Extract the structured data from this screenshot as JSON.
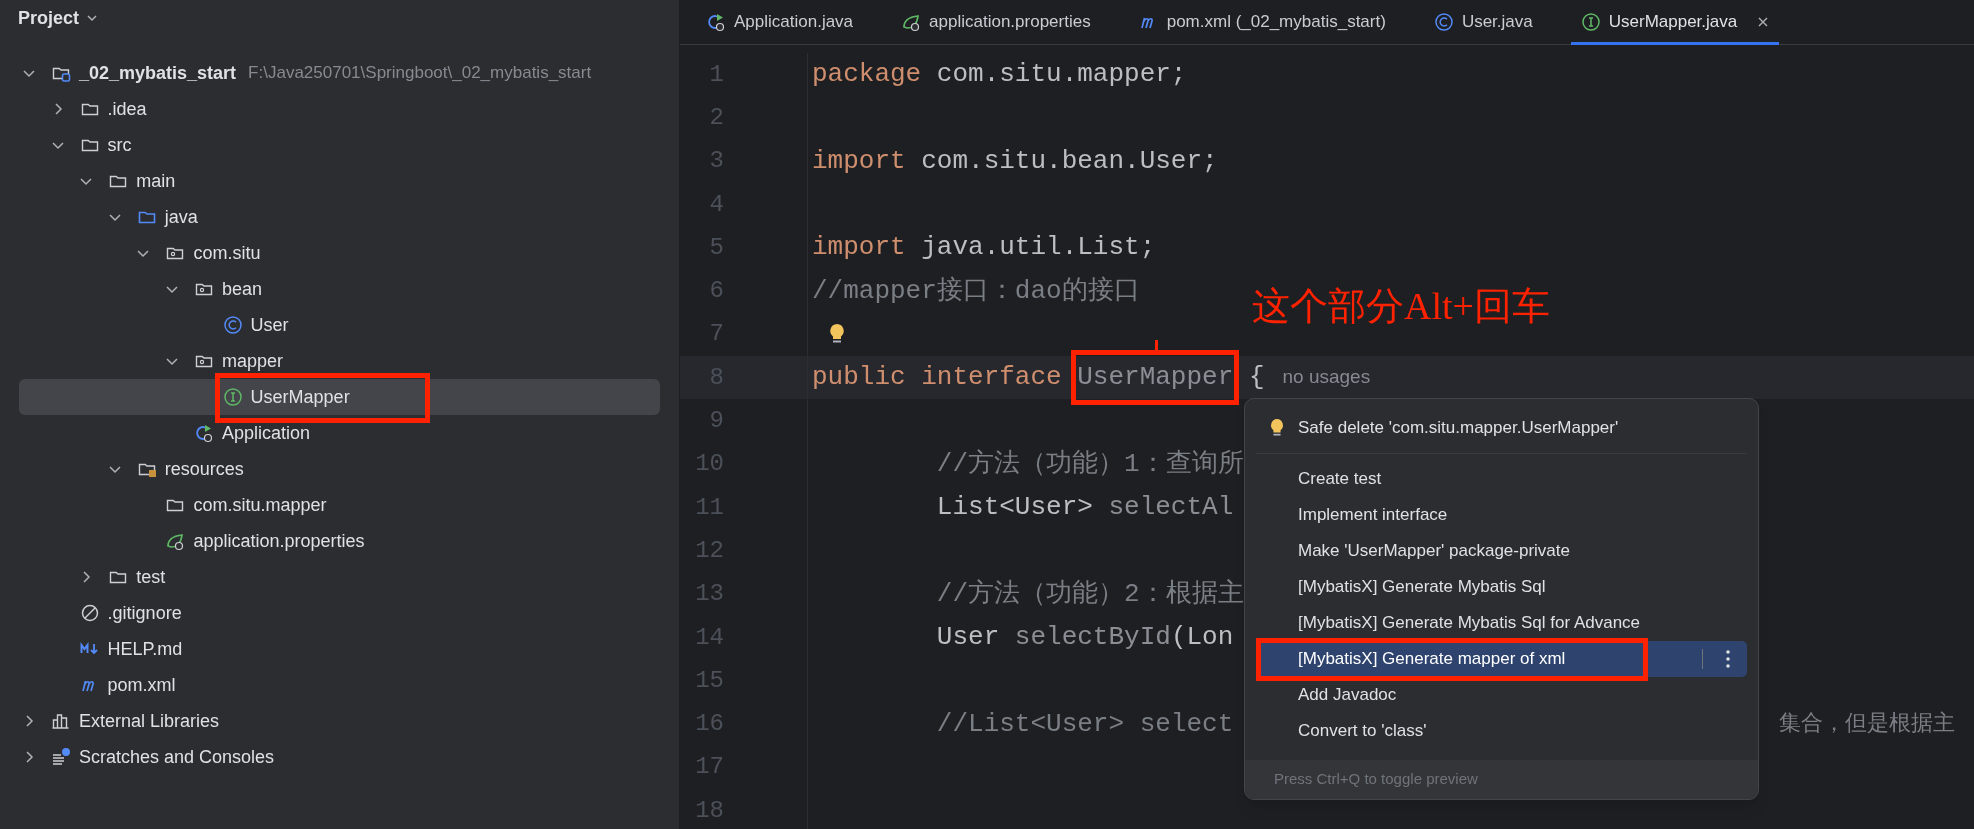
{
  "sidebar": {
    "title": "Project",
    "tree": [
      {
        "label": "_02_mybatis_start",
        "path": "F:\\Java250701\\Springboot\\_02_mybatis_start",
        "kind": "module",
        "expanded": true,
        "selected": false,
        "children": [
          {
            "label": ".idea",
            "kind": "folder",
            "expanded": false,
            "selected": false
          },
          {
            "label": "src",
            "kind": "folder",
            "expanded": true,
            "selected": false,
            "children": [
              {
                "label": "main",
                "kind": "folder",
                "expanded": true,
                "selected": false,
                "children": [
                  {
                    "label": "java",
                    "kind": "source-folder",
                    "expanded": true,
                    "selected": false,
                    "children": [
                      {
                        "label": "com.situ",
                        "kind": "package",
                        "expanded": true,
                        "selected": false,
                        "children": [
                          {
                            "label": "bean",
                            "kind": "package",
                            "expanded": true,
                            "selected": false,
                            "children": [
                              {
                                "label": "User",
                                "kind": "class",
                                "selected": false
                              }
                            ]
                          },
                          {
                            "label": "mapper",
                            "kind": "package",
                            "expanded": true,
                            "selected": false,
                            "children": [
                              {
                                "label": "UserMapper",
                                "kind": "interface",
                                "selected": true,
                                "highlighted": true
                              }
                            ]
                          },
                          {
                            "label": "Application",
                            "kind": "spring-app",
                            "selected": false
                          }
                        ]
                      }
                    ]
                  },
                  {
                    "label": "resources",
                    "kind": "resources-folder",
                    "expanded": true,
                    "selected": false,
                    "children": [
                      {
                        "label": "com.situ.mapper",
                        "kind": "folder",
                        "selected": false
                      },
                      {
                        "label": "application.properties",
                        "kind": "spring-properties",
                        "selected": false
                      }
                    ]
                  }
                ]
              },
              {
                "label": "test",
                "kind": "folder",
                "expanded": false,
                "selected": false
              }
            ]
          },
          {
            "label": ".gitignore",
            "kind": "gitignore",
            "selected": false
          },
          {
            "label": "HELP.md",
            "kind": "markdown",
            "selected": false
          },
          {
            "label": "pom.xml",
            "kind": "maven",
            "selected": false
          }
        ]
      },
      {
        "label": "External Libraries",
        "kind": "libraries",
        "expanded": false,
        "selected": false
      },
      {
        "label": "Scratches and Consoles",
        "kind": "scratches",
        "expanded": false,
        "selected": false
      }
    ]
  },
  "tabs": [
    {
      "label": "Application.java",
      "kind": "spring-app",
      "selected": false
    },
    {
      "label": "application.properties",
      "kind": "spring-properties",
      "selected": false
    },
    {
      "label": "pom.xml (_02_mybatis_start)",
      "kind": "maven",
      "selected": false
    },
    {
      "label": "User.java",
      "kind": "class",
      "selected": false
    },
    {
      "label": "UserMapper.java",
      "kind": "interface",
      "selected": true
    }
  ],
  "editor": {
    "lines": [
      {
        "number": "1",
        "tokens": [
          {
            "text": "package",
            "kind": "keyword"
          },
          {
            "text": " com.situ.mapper;",
            "kind": "plain"
          }
        ]
      },
      {
        "number": "2"
      },
      {
        "number": "3",
        "tokens": [
          {
            "text": "import",
            "kind": "keyword"
          },
          {
            "text": " com.situ.bean.User;",
            "kind": "plain"
          }
        ]
      },
      {
        "number": "4"
      },
      {
        "number": "5",
        "tokens": [
          {
            "text": "import",
            "kind": "keyword"
          },
          {
            "text": " java.util.List;",
            "kind": "plain"
          }
        ]
      },
      {
        "number": "6",
        "tokens": [
          {
            "text": "//mapper接口：dao的接口",
            "kind": "comment"
          }
        ]
      },
      {
        "number": "7",
        "bulb": true
      },
      {
        "number": "8",
        "current": true,
        "tokens": [
          {
            "text": "public interface ",
            "kind": "keyword"
          },
          {
            "text": "UserMapper",
            "kind": "unused",
            "highlighted": true
          },
          {
            "text": " {",
            "kind": "plain"
          }
        ],
        "hint": "no usages"
      },
      {
        "number": "9"
      },
      {
        "number": "10",
        "tokens": [
          {
            "text": "        //方法（功能）1：查询所",
            "kind": "comment"
          }
        ]
      },
      {
        "number": "11",
        "tokens": [
          {
            "text": "        List<User> ",
            "kind": "plain"
          },
          {
            "text": "selectAl",
            "kind": "unused"
          }
        ]
      },
      {
        "number": "12"
      },
      {
        "number": "13",
        "tokens": [
          {
            "text": "        //方法（功能）2：根据主",
            "kind": "comment"
          }
        ]
      },
      {
        "number": "14",
        "tokens": [
          {
            "text": "        User ",
            "kind": "plain"
          },
          {
            "text": "selectById",
            "kind": "unused"
          },
          {
            "text": "(Lon",
            "kind": "plain"
          }
        ]
      },
      {
        "number": "15"
      },
      {
        "number": "16",
        "tokens": [
          {
            "text": "        //List<User> select",
            "kind": "comment"
          }
        ],
        "tail": "集合，但是根据主"
      },
      {
        "number": "17"
      },
      {
        "number": "18"
      }
    ]
  },
  "popup": {
    "items": [
      {
        "label": "Safe delete 'com.situ.mapper.UserMapper'",
        "kind": "intention",
        "selected": false
      },
      {
        "label": "Create test",
        "kind": "action",
        "selected": false
      },
      {
        "label": "Implement interface",
        "kind": "action",
        "selected": false
      },
      {
        "label": "Make 'UserMapper' package-private",
        "kind": "action",
        "selected": false
      },
      {
        "label": "[MybatisX] Generate Mybatis Sql",
        "kind": "action",
        "selected": false
      },
      {
        "label": "[MybatisX] Generate Mybatis Sql for Advance",
        "kind": "action",
        "selected": false
      },
      {
        "label": "[MybatisX] Generate mapper of xml",
        "kind": "action",
        "selected": true,
        "highlighted": true
      },
      {
        "label": "Add Javadoc",
        "kind": "action",
        "selected": false
      },
      {
        "label": "Convert to 'class'",
        "kind": "action",
        "selected": false
      }
    ],
    "footer": "Press Ctrl+Q to toggle preview"
  },
  "annotation": {
    "text": "这个部分Alt+回车"
  }
}
